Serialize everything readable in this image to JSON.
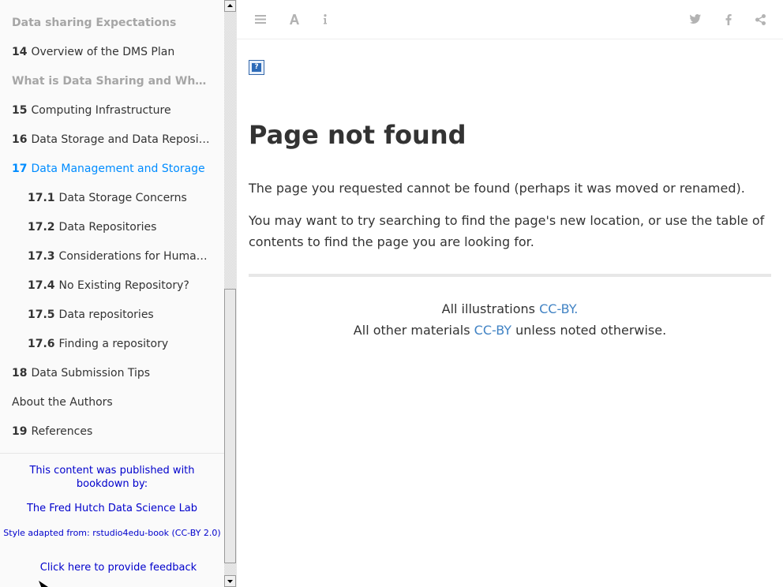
{
  "sidebar": {
    "items": [
      {
        "num": "",
        "label": "Data sharing Expectations",
        "state": "muted"
      },
      {
        "num": "14",
        "label": "Overview of the DMS Plan",
        "state": "normal"
      },
      {
        "num": "",
        "label": "What is Data Sharing and Why Share Data?",
        "state": "muted"
      },
      {
        "num": "15",
        "label": "Computing Infrastructure",
        "state": "normal"
      },
      {
        "num": "16",
        "label": "Data Storage and Data Repositories",
        "state": "normal"
      },
      {
        "num": "17",
        "label": "Data Management and Storage",
        "state": "active"
      },
      {
        "num": "17.1",
        "label": "Data Storage Concerns",
        "state": "normal"
      },
      {
        "num": "17.2",
        "label": "Data Repositories",
        "state": "normal"
      },
      {
        "num": "17.3",
        "label": "Considerations for Human Data",
        "state": "normal"
      },
      {
        "num": "17.4",
        "label": "No Existing Repository?",
        "state": "normal"
      },
      {
        "num": "17.5",
        "label": "Data repositories",
        "state": "normal"
      },
      {
        "num": "17.6",
        "label": "Finding a repository",
        "state": "normal"
      },
      {
        "num": "18",
        "label": "Data Submission Tips",
        "state": "normal"
      },
      {
        "num": "",
        "label": "About the Authors",
        "state": "normal"
      },
      {
        "num": "19",
        "label": "References",
        "state": "normal"
      }
    ],
    "credits": {
      "published": "This content was published with bookdown by:",
      "lab": "The Fred Hutch Data Science Lab",
      "style": "Style adapted from: rstudio4edu-book (CC-BY 2.0)",
      "feedback": "Click here to provide feedback"
    }
  },
  "toolbar": {
    "icons": [
      "menu-icon",
      "font-icon",
      "info-icon",
      "twitter-icon",
      "facebook-icon",
      "share-icon"
    ],
    "color": "#b3b3b3"
  },
  "main": {
    "title": "Page not found",
    "para1": "The page you requested cannot be found (perhaps it was moved or renamed).",
    "para2": "You may want to try searching to find the page's new location, or use the table of contents to find the page you are looking for.",
    "license": {
      "line1_prefix": "All illustrations ",
      "line1_link": "CC-BY.",
      "line2_prefix": "All other materials ",
      "line2_link": "CC-BY",
      "line2_suffix": " unless noted otherwise."
    }
  },
  "colors": {
    "active": "#008cff",
    "link": "#4183c4",
    "credit": "#0000cc",
    "muted": "#a6a6a6"
  }
}
